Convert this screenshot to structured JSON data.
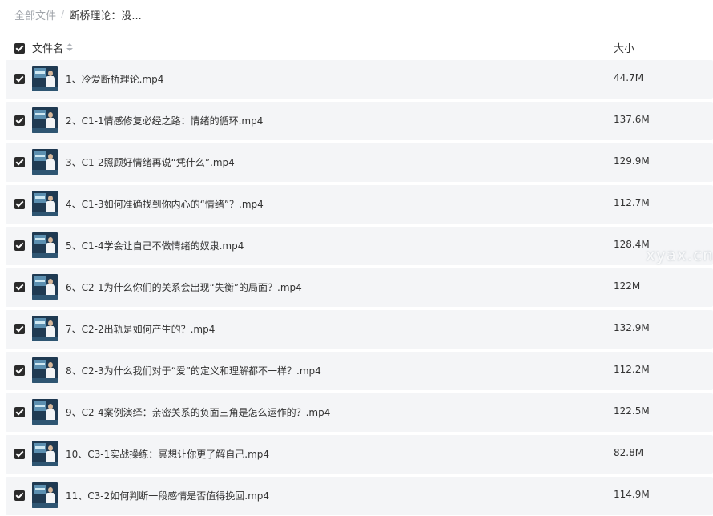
{
  "breadcrumb": {
    "root": "全部文件",
    "separator": "/",
    "current": "断桥理论：没..."
  },
  "header": {
    "name_label": "文件名",
    "size_label": "大小"
  },
  "files": [
    {
      "name": "1、冷爱断桥理论.mp4",
      "size": "44.7M"
    },
    {
      "name": "2、C1-1情感修复必经之路：情绪的循环.mp4",
      "size": "137.6M"
    },
    {
      "name": "3、C1-2照顾好情绪再说“凭什么”.mp4",
      "size": "129.9M"
    },
    {
      "name": "4、C1-3如何准确找到你内心的“情绪”？.mp4",
      "size": "112.7M"
    },
    {
      "name": "5、C1-4学会让自己不做情绪的奴隶.mp4",
      "size": "128.4M"
    },
    {
      "name": "6、C2-1为什么你们的关系会出现“失衡”的局面？.mp4",
      "size": "122M"
    },
    {
      "name": "7、C2-2出轨是如何产生的？.mp4",
      "size": "132.9M"
    },
    {
      "name": "8、C2-3为什么我们对于“爱”的定义和理解都不一样？.mp4",
      "size": "112.2M"
    },
    {
      "name": "9、C2-4案例演绎：亲密关系的负面三角是怎么运作的？.mp4",
      "size": "122.5M"
    },
    {
      "name": "10、C3-1实战操练：冥想让你更了解自己.mp4",
      "size": "82.8M"
    },
    {
      "name": "11、C3-2如何判断一段感情是否值得挽回.mp4",
      "size": "114.9M"
    }
  ],
  "watermark": "xyax.cn"
}
